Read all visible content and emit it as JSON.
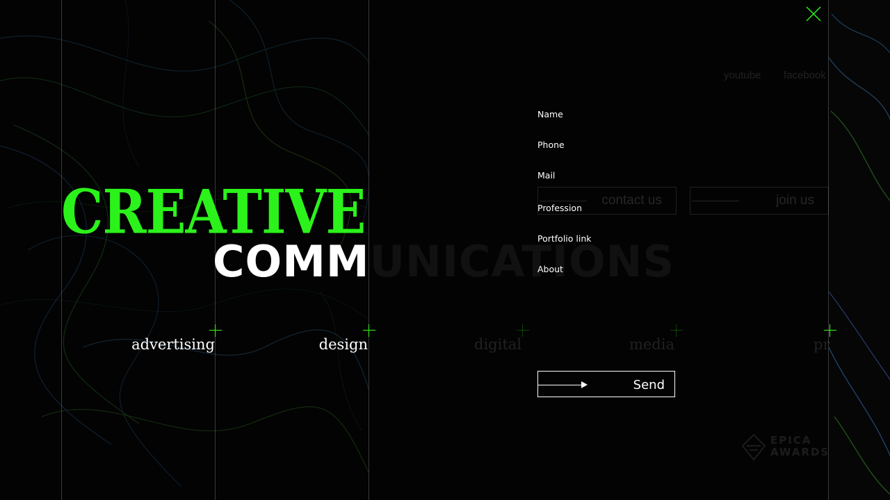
{
  "headline": {
    "line1": "CREATIVE",
    "line2_visible": "COMM",
    "line2_faded": "UNICATIONS"
  },
  "services": [
    {
      "label": "advertising"
    },
    {
      "label": "design"
    },
    {
      "label": "digital"
    },
    {
      "label": "media"
    },
    {
      "label": "pr"
    }
  ],
  "social": {
    "youtube": "youtube",
    "facebook": "facebook"
  },
  "background_buttons": {
    "contact": "contact us",
    "join": "join us"
  },
  "form": {
    "fields": [
      {
        "label": "Name",
        "value": ""
      },
      {
        "label": "Phone",
        "value": ""
      },
      {
        "label": "Mail",
        "value": ""
      },
      {
        "label": "Profession",
        "value": ""
      },
      {
        "label": "Portfolio link",
        "value": ""
      },
      {
        "label": "About",
        "value": ""
      }
    ],
    "submit_label": "Send"
  },
  "logo": {
    "line1": "EPICA",
    "line2": "AWARDS"
  },
  "icons": {
    "close": "close-icon",
    "send_arrow": "arrow-right-icon",
    "logo_mark": "epica-logo-icon"
  },
  "colors": {
    "accent": "#2cf21b",
    "background": "#050605",
    "text": "#ffffff"
  }
}
